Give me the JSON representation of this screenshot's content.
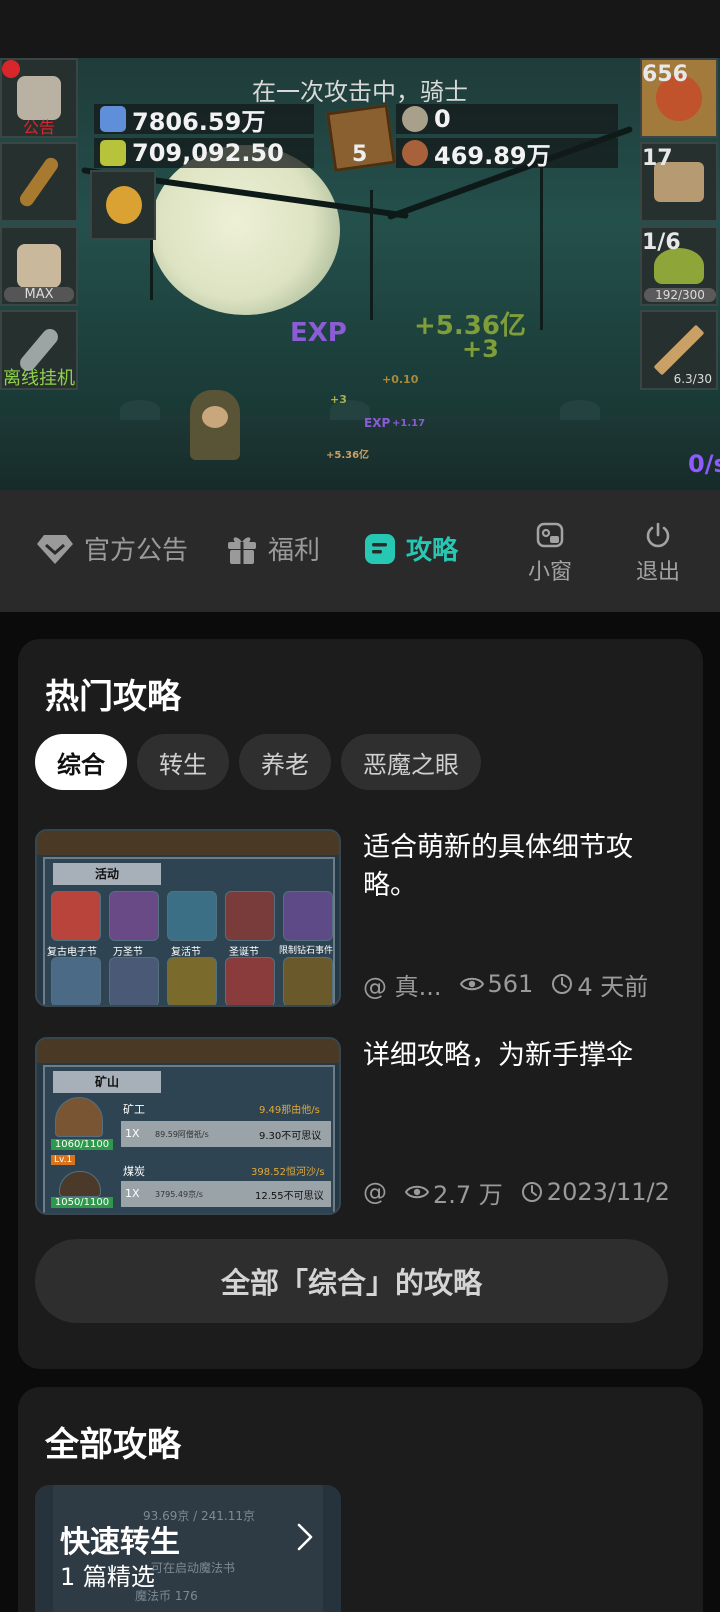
{
  "game": {
    "message": "在一次攻击中，骑士",
    "resources": {
      "potion_blue": "7806.59万",
      "potion_green": "709,092.50",
      "silver": "0",
      "bronze": "469.89万",
      "book_count": "5"
    },
    "left_tiles": {
      "notice_label": "公告",
      "max_label": "MAX",
      "offline_label": "离线挂机"
    },
    "right_tiles": {
      "potion_count": "656",
      "chest_count": "17",
      "slime_count": "1/6",
      "slime_bar": "192/300",
      "sword_bar": "6.3/30"
    },
    "floats": {
      "big_gain": "+5.36亿",
      "plus3": "+3",
      "exp": "EXP",
      "small_010": "+0.10",
      "small_plus3": "+3",
      "exp_small": "+1.17",
      "coin_small": "+5.36亿"
    },
    "rate": "0/s"
  },
  "nav": {
    "items": [
      {
        "label": "官方公告",
        "icon": "diamond-icon"
      },
      {
        "label": "福利",
        "icon": "gift-icon"
      },
      {
        "label": "攻略",
        "icon": "guide-icon"
      }
    ],
    "mini_window": "小窗",
    "exit": "退出"
  },
  "hot": {
    "title": "热门攻略",
    "chips": [
      "综合",
      "转生",
      "养老",
      "恶魔之眼"
    ],
    "articles": [
      {
        "title": "适合萌新的具体细节攻略。",
        "author": "@ 真...",
        "views": "561",
        "time": "4 天前",
        "thumb_header": "活动",
        "thumb_labels": [
          "复古电子节",
          "万圣节",
          "复活节",
          "圣诞节",
          "限制钻石事件"
        ]
      },
      {
        "title": "详细攻略，为新手撑伞",
        "author": "@",
        "views": "2.7 万",
        "time": "2023/11/2",
        "thumb_header": "矿山",
        "thumb_rows": [
          {
            "name": "矿工",
            "rate": "9.49那由他/s",
            "hp": "1060/1100",
            "mult": "1X",
            "sub": "89.59阿僧祇/s",
            "value": "9.30不可思议"
          },
          {
            "name": "煤炭",
            "rate": "398.52恒河沙/s",
            "hp": "1050/1100",
            "mult": "1X",
            "sub": "3795.49京/s",
            "value": "12.55不可思议"
          }
        ],
        "lv": "Lv.1"
      }
    ],
    "all_button": "全部「综合」的攻略"
  },
  "all": {
    "title": "全部攻略",
    "tile_title": "快速转生",
    "tile_sub": "1 篇精选",
    "ghost1": "93.69京 / 241.11京",
    "ghost2": "魔法币 176",
    "ghost3": "可在启动魔法书"
  },
  "colors": {
    "accent": "#27c8b3",
    "card_bg": "#1c1c1c",
    "nav_bg": "#2a2a2a"
  }
}
